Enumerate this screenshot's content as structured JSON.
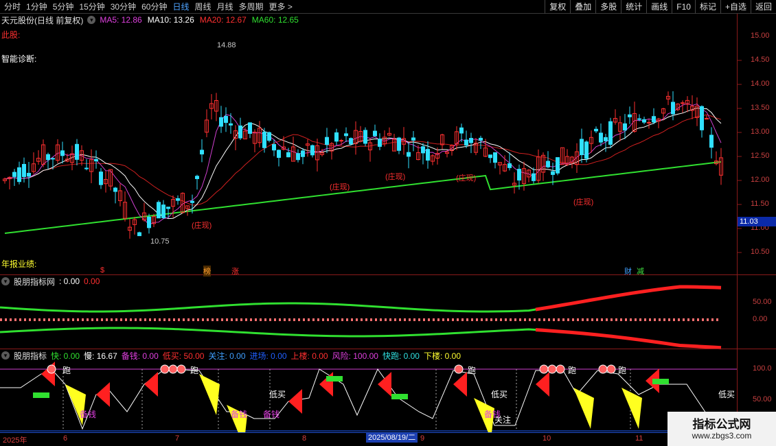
{
  "toolbar": {
    "period_tabs": [
      "分时",
      "1分钟",
      "5分钟",
      "15分钟",
      "30分钟",
      "60分钟",
      "日线",
      "周线",
      "月线",
      "多周期",
      "更多 >"
    ],
    "active_tab": "日线",
    "buttons": [
      "复权",
      "叠加",
      "多股",
      "统计",
      "画线",
      "F10",
      "标记",
      "+自选",
      "返回"
    ]
  },
  "main_panel": {
    "title": "天元股份(日线 前复权)",
    "ma": [
      {
        "label": "MA5: 12.86",
        "color": "#e040e0"
      },
      {
        "label": "MA10: 13.26",
        "color": "#ffffff"
      },
      {
        "label": "MA20: 12.67",
        "color": "#ff3030"
      },
      {
        "label": "MA60: 12.65",
        "color": "#30e030"
      }
    ],
    "label_cigu": "此股:",
    "label_diag": "智能诊断:",
    "label_annual": "年报业绩:",
    "high_label": "14.88",
    "low_label": "10.75",
    "zhuang_label": "(庄现)",
    "last_price": "11.03",
    "yticks": [
      "15.00",
      "14.50",
      "14.00",
      "13.50",
      "13.00",
      "12.50",
      "12.00",
      "11.50",
      "11.00",
      "10.50"
    ],
    "event_marks": [
      {
        "text": "$",
        "color": "#ff3030"
      },
      {
        "text": "榜",
        "color": "#ffa030"
      },
      {
        "text": "涨",
        "color": "#ff3030"
      },
      {
        "text": "财",
        "color": "#40a0ff"
      },
      {
        "text": "减",
        "color": "#40e040"
      }
    ]
  },
  "panel2": {
    "title": "股朋指标网",
    "v1": ": 0.00",
    "v2": "0.00",
    "yticks": [
      "50.00",
      "0.00"
    ]
  },
  "panel3": {
    "title": "股朋指标",
    "values": [
      {
        "label": "快: 0.00",
        "color": "#30e030"
      },
      {
        "label": "慢: 16.67",
        "color": "#ffffff"
      },
      {
        "label": "备钱: 0.00",
        "color": "#e040e0"
      },
      {
        "label": "低买: 50.00",
        "color": "#ff3030"
      },
      {
        "label": "关注: 0.00",
        "color": "#40a0ff"
      },
      {
        "label": "进场: 0.00",
        "color": "#2060ff"
      },
      {
        "label": "上楼: 0.00",
        "color": "#ff3030"
      },
      {
        "label": "风险: 100.00",
        "color": "#e040e0"
      },
      {
        "label": "快跑: 0.00",
        "color": "#30e0e0"
      },
      {
        "label": "下楼: 0.00",
        "color": "#ffff30"
      }
    ],
    "yticks": [
      "100.0",
      "50.00"
    ],
    "signal_pao": "跑",
    "signal_dimai": "低买",
    "signal_beiqian": "备钱",
    "signal_guanzhu": "关注"
  },
  "xaxis": {
    "labels": [
      "2025年",
      "6",
      "7",
      "8",
      "9",
      "10",
      "11"
    ],
    "cursor_date": "2025/08/19/二"
  },
  "watermark": {
    "title": "指标公式网",
    "url": "www.zbgs3.com"
  }
}
